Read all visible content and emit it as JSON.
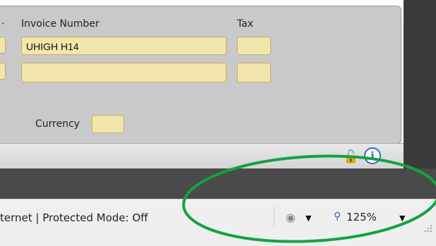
{
  "form": {
    "invoice_number_label": "Invoice Number",
    "tax_label": "Tax",
    "invoice_number_value": "UHIGH H14",
    "invoice_number_value_2": "",
    "tax_value": "",
    "tax_value_2": "",
    "currency_label": "Currency",
    "currency_value": ""
  },
  "toolbar": {
    "lock_icon": "lock-icon",
    "info_icon": "info-icon",
    "info_glyph": "i"
  },
  "statusbar": {
    "zone_text": "ternet | Protected Mode: Off",
    "zoom_text": "125%"
  },
  "colors": {
    "field_fill": "#f2e6ad",
    "panel_gray": "#c9c9c9",
    "annotation_green": "#13a33e"
  }
}
